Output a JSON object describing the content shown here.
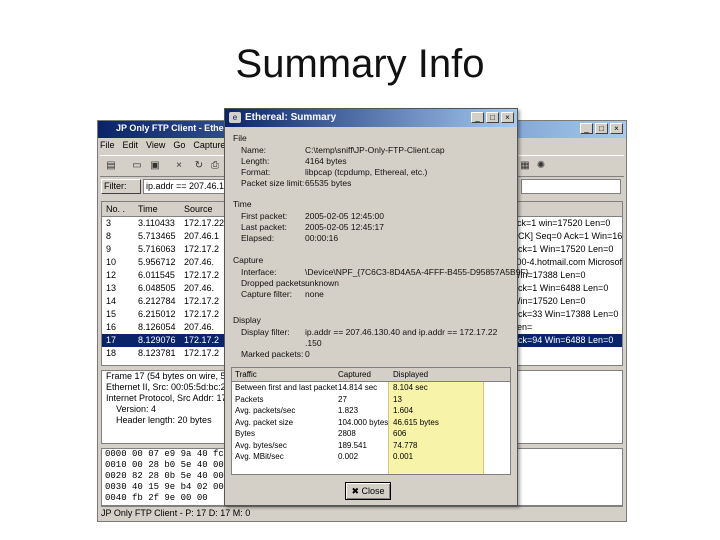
{
  "slide": {
    "title": "Summary Info"
  },
  "bg_window": {
    "title": "JP Only FTP Client - Ethereal",
    "menu": [
      "File",
      "Edit",
      "View",
      "Go",
      "Capture"
    ],
    "filter_button": "Filter:",
    "filter_value": "ip.addr == 207.46.130.0",
    "columns": [
      "No. .",
      "Time",
      "Source"
    ],
    "rows": [
      {
        "no": "3",
        "time": "3.110433",
        "src": "172.17.22",
        "info": "ack=1 win=17520 Len=0"
      },
      {
        "no": "8",
        "time": "5.713465",
        "src": "207.46.1",
        "info": "ACK] Seq=0 Ack=1 Win=1621"
      },
      {
        "no": "9",
        "time": "5.716063",
        "src": "172.17.2",
        "info": "Ack=1 Win=17520 Len=0"
      },
      {
        "no": "10",
        "time": "5.956712",
        "src": "207.46.",
        "info": "c00-4.hotmail.com Microsoft"
      },
      {
        "no": "12",
        "time": "6.011545",
        "src": "172.17.2",
        "info": "Win=17388 Len=0"
      },
      {
        "no": "13",
        "time": "6.048505",
        "src": "207.46.",
        "info": "Ack=1 Win=6488 Len=0"
      },
      {
        "no": "14",
        "time": "6.212784",
        "src": "172.17.2",
        "info": "Win=17520 Len=0"
      },
      {
        "no": "15",
        "time": "6.215012",
        "src": "172.17.2",
        "info": "Ack=33 Win=17388 Len=0"
      },
      {
        "no": "16",
        "time": "8.126054",
        "src": "207.46.",
        "info": "Len="
      },
      {
        "no": "17",
        "time": "8.129076",
        "src": "172.17.2",
        "info": "Ack=94 Win=6488 Len=0"
      },
      {
        "no": "18",
        "time": "8.123781",
        "src": "172.17.2",
        "info": ""
      }
    ],
    "details": [
      "Frame 17 (54 bytes on wire, 54 bytes captured)",
      "Ethernet II, Src: 00:05:5d:bc:2a",
      "Internet Protocol, Src Addr: 172.17.22.9",
      "Version: 4",
      "Header length: 20 bytes"
    ],
    "hex": [
      "0000  00 07 e9 9a 40 fc 00 05 5d bc",
      "0010  00 28 b0 5e 40 00 80 06 59 bc",
      "0020  82 28 0b 5e 40 00 80 06 54 b8",
      "0030  40 15 9e b4 02 00 9d fe 5e 22",
      "0040  fb 2f 9e 00 00"
    ],
    "status": "JP Only FTP Client - P: 17 D: 17 M: 0"
  },
  "dialog": {
    "title": "Ethereal: Summary",
    "file": {
      "group": "File",
      "name_label": "Name:",
      "name": "C:\\temp\\sniff\\JP-Only-FTP-Client.cap",
      "length_label": "Length:",
      "length": "4164 bytes",
      "format_label": "Format:",
      "format": "libpcap (tcpdump, Ethereal, etc.)",
      "snaplen_label": "Packet size limit:",
      "snaplen": "65535 bytes"
    },
    "time": {
      "group": "Time",
      "first_label": "First packet:",
      "first": "2005-02-05 12:45:00",
      "last_label": "Last packet:",
      "last": "2005-02-05 12:45:17",
      "elapsed_label": "Elapsed:",
      "elapsed": "00:00:16"
    },
    "capture": {
      "group": "Capture",
      "iface_label": "Interface:",
      "iface": "\\Device\\NPF_{7C6C3-8D4A5A-4FFF-B455-D95857A5B9F}",
      "dropped_label": "Dropped packets:",
      "dropped": "unknown",
      "filter_label": "Capture filter:",
      "filter": "none"
    },
    "display": {
      "group": "Display",
      "filter_label": "Display filter:",
      "filter_line1": "ip.addr == 207.46.130.40 and ip.addr == 172.17.22",
      "filter_line2": ".150",
      "marked_label": "Marked packets:",
      "marked": "0"
    },
    "traffic": {
      "headers": [
        "Traffic",
        "Captured",
        "Displayed"
      ],
      "rows": [
        {
          "label": "Between first and last packet",
          "captured": "14.814 sec",
          "displayed": "8.104 sec"
        },
        {
          "label": "Packets",
          "captured": "27",
          "displayed": "13"
        },
        {
          "label": "Avg. packets/sec",
          "captured": "1.823",
          "displayed": "1.604"
        },
        {
          "label": "Avg. packet size",
          "captured": "104.000 bytes",
          "displayed": "46.615 bytes"
        },
        {
          "label": "Bytes",
          "captured": "2808",
          "displayed": "606"
        },
        {
          "label": "Avg. bytes/sec",
          "captured": "189.541",
          "displayed": "74.778"
        },
        {
          "label": "Avg. MBit/sec",
          "captured": "0.002",
          "displayed": "0.001"
        }
      ]
    },
    "close_label": "Close"
  },
  "colors": {
    "titlebar": "#0a246a",
    "highlight": "#f6f29a",
    "window": "#d4d0c8"
  }
}
